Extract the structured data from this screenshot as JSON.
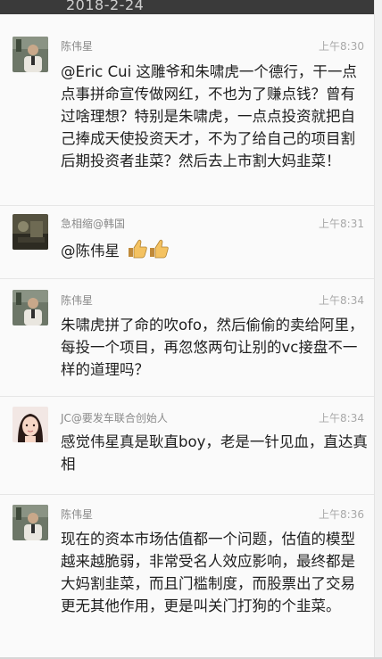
{
  "header": {
    "date": "2018-2-24"
  },
  "comments": [
    {
      "username": "陈伟星",
      "time": "上午8:30",
      "text": "@Eric Cui 这雕爷和朱啸虎一个德行，干一点点事拼命宣传做网红，不也为了赚点钱？曾有过啥理想？特别是朱啸虎，一点点投资就把自己捧成天使投资天才，不为了给自己的项目割后期投资者韭菜？然后去上市割大妈韭菜！"
    },
    {
      "username": "急相缩@韩国",
      "time": "上午8:31",
      "text": "@陈伟星",
      "emoji": "thumbs-up-icon"
    },
    {
      "username": "陈伟星",
      "time": "上午8:34",
      "text": "朱啸虎拼了命的吹ofo，然后偷偷的卖给阿里，每投一个项目，再忽悠两句让别的vc接盘不一样的道理吗？"
    },
    {
      "username": "JC@要发车联合创始人",
      "time": "上午8:34",
      "text": "感觉伟星真是耿直boy，老是一针见血，直达真相"
    },
    {
      "username": "陈伟星",
      "time": "上午8:36",
      "text": "现在的资本市场估值都一个问题，估值的模型越来越脆弱，非常受名人效应影响，最终都是大妈割韭菜，而且门槛制度，而股票出了交易更无其他作用，更是叫关门打狗的个韭菜。"
    }
  ]
}
